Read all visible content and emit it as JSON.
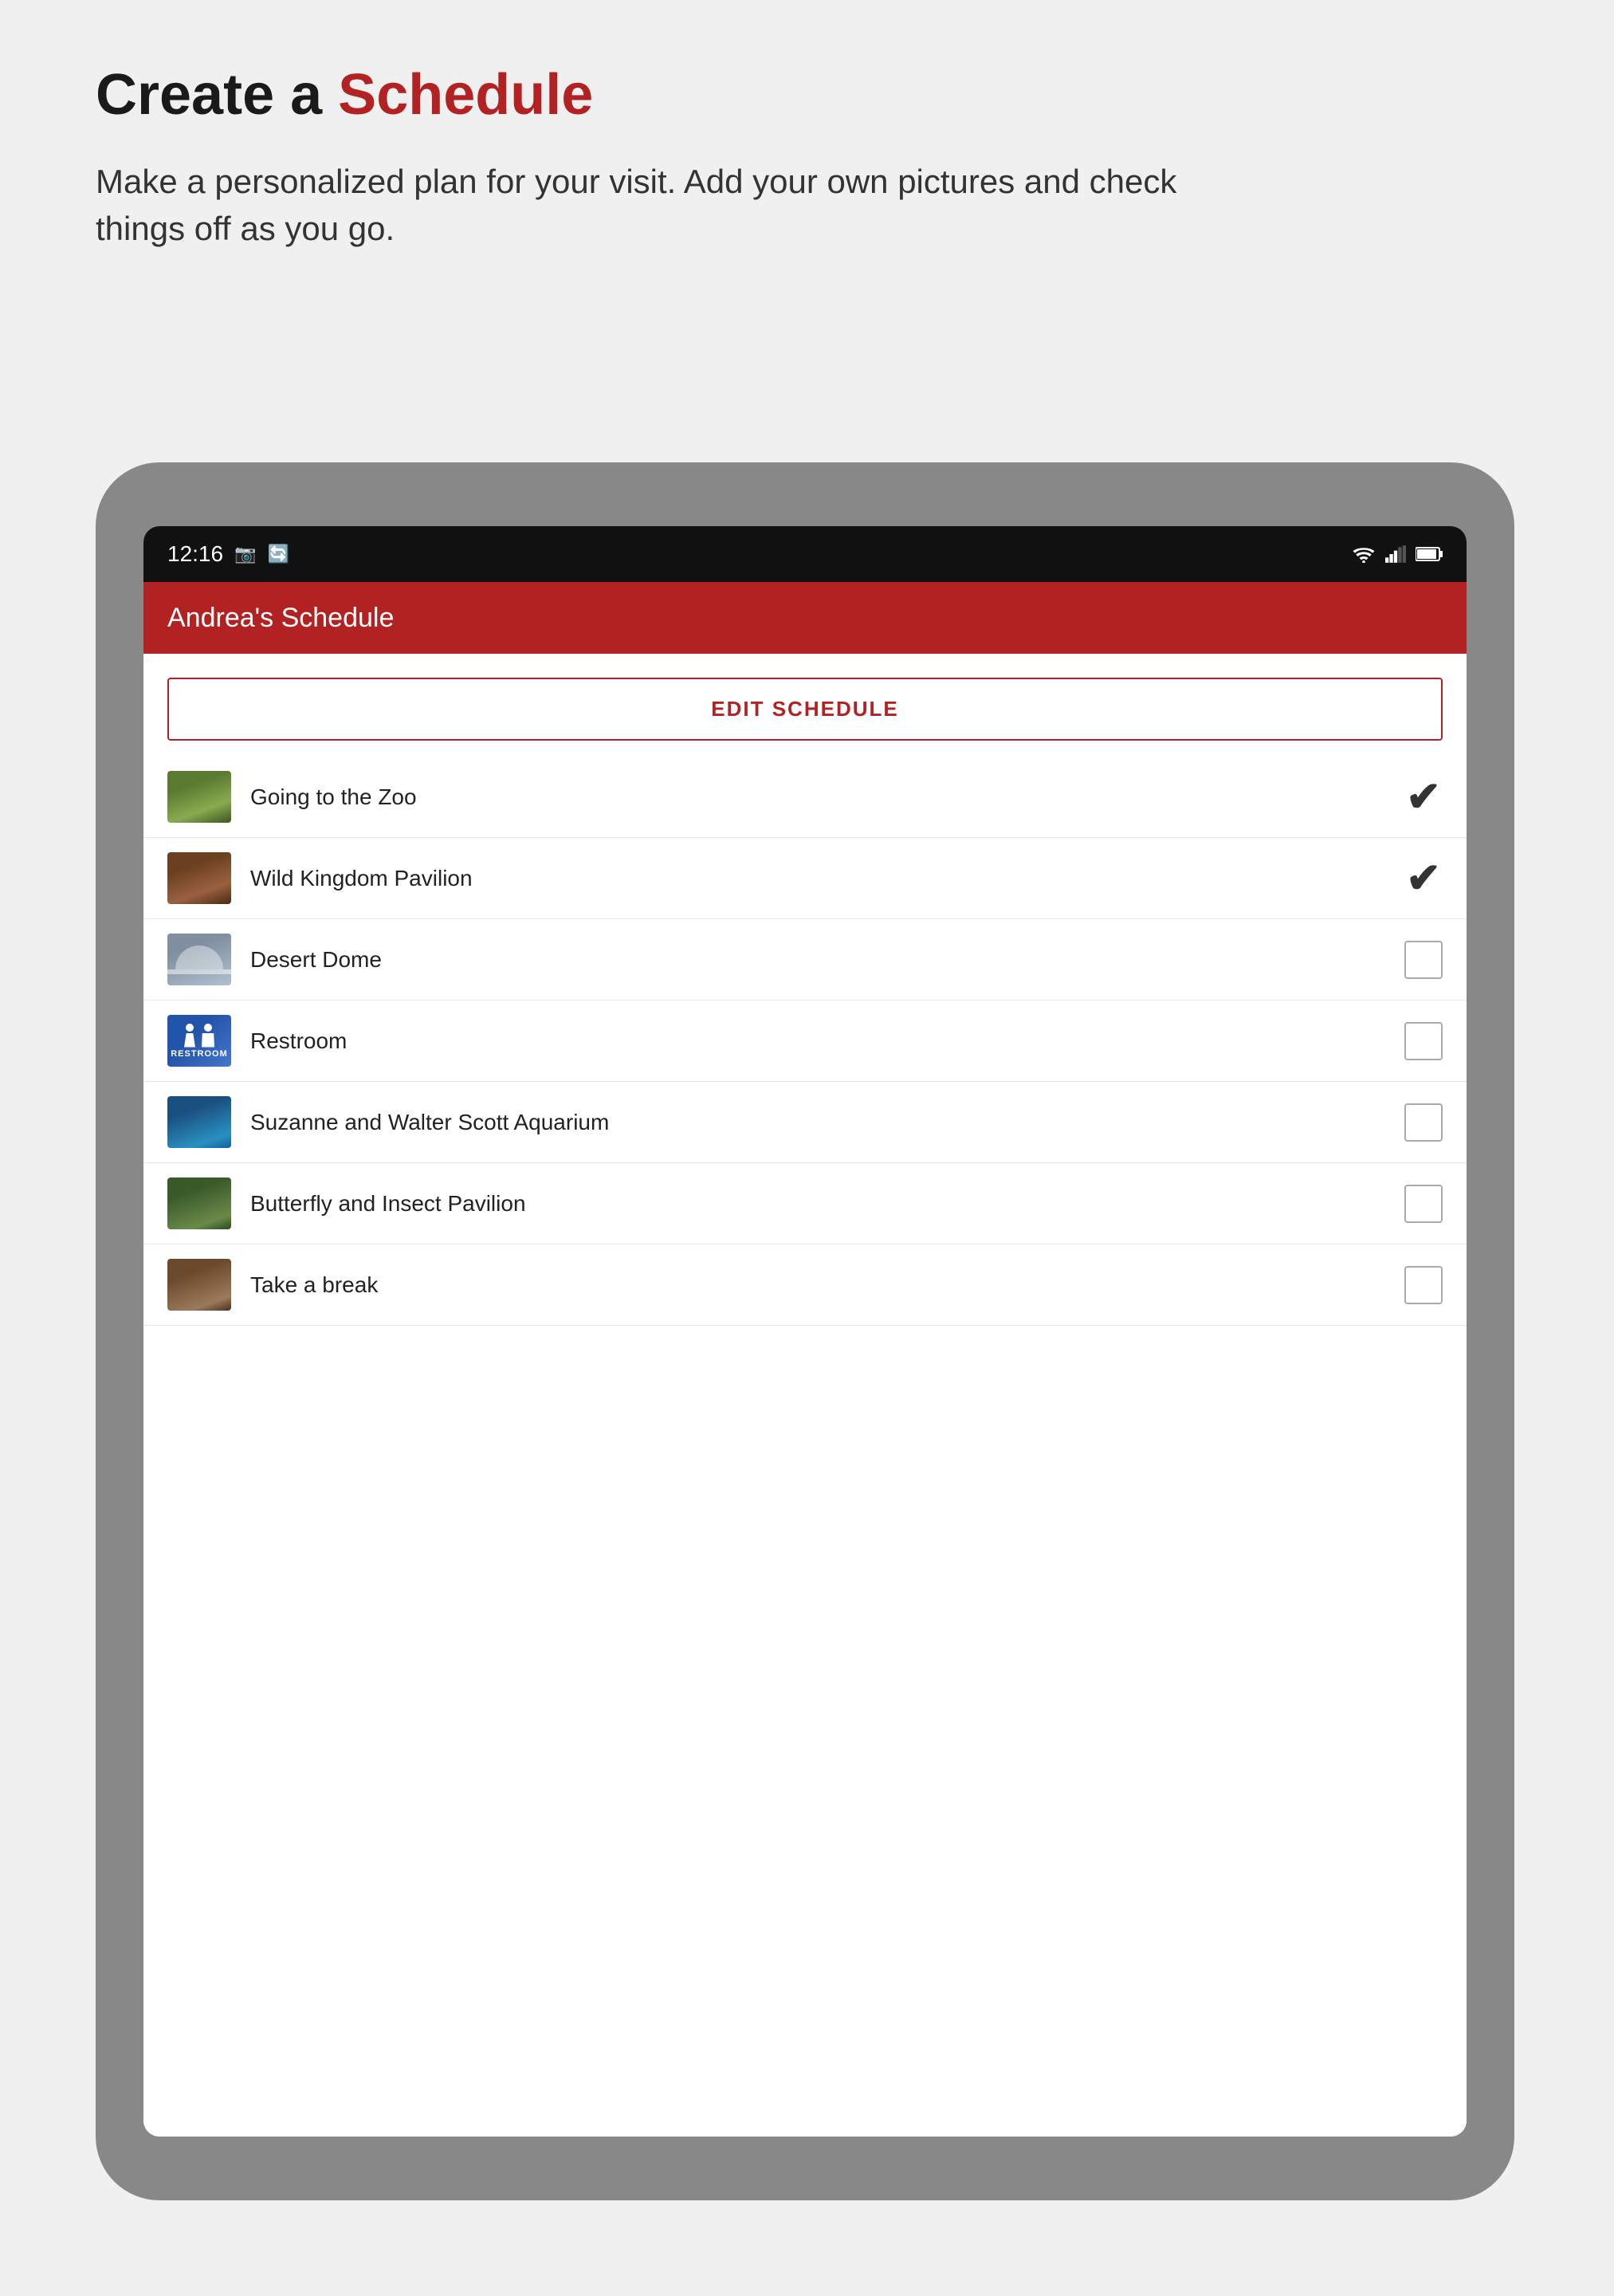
{
  "page": {
    "headline_prefix": "Create a ",
    "headline_highlight": "Schedule",
    "subtitle": "Make a personalized plan for your visit. Add your own pictures and check things off as you go."
  },
  "statusBar": {
    "time": "12:16",
    "icons_left": [
      "📶",
      "📷"
    ],
    "icons_right": [
      "wifi",
      "signal",
      "battery"
    ]
  },
  "app": {
    "title": "Andrea's Schedule",
    "edit_button": "EDIT SCHEDULE"
  },
  "scheduleItems": [
    {
      "id": 1,
      "label": "Going to the Zoo",
      "imgClass": "img-zoo",
      "checked": true
    },
    {
      "id": 2,
      "label": "Wild Kingdom Pavilion",
      "imgClass": "img-wild",
      "checked": true
    },
    {
      "id": 3,
      "label": "Desert Dome",
      "imgClass": "img-desert",
      "checked": false
    },
    {
      "id": 4,
      "label": "Restroom",
      "imgClass": "img-restroom",
      "checked": false,
      "isRestroom": true
    },
    {
      "id": 5,
      "label": "Suzanne and Walter Scott Aquarium",
      "imgClass": "img-aquarium",
      "checked": false
    },
    {
      "id": 6,
      "label": "Butterfly and Insect Pavilion",
      "imgClass": "img-butterfly",
      "checked": false
    },
    {
      "id": 7,
      "label": "Take a break",
      "imgClass": "img-break",
      "checked": false
    }
  ]
}
